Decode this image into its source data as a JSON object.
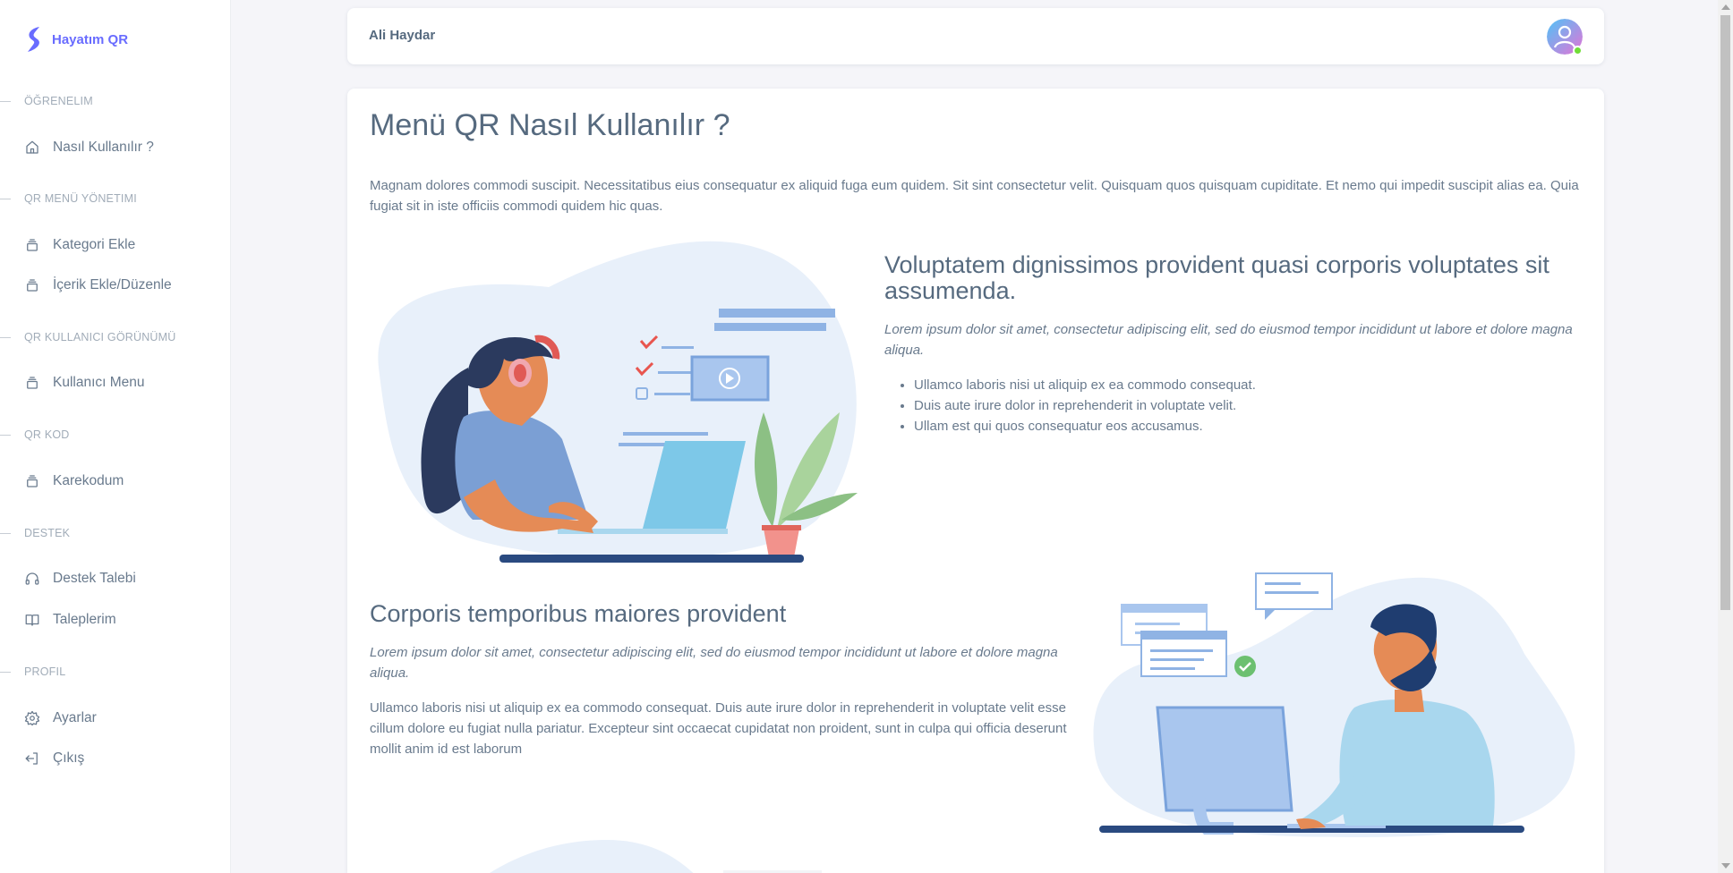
{
  "sidebar": {
    "brand": "Hayatım QR",
    "sections": [
      {
        "header": "ÖĞRENELIM",
        "items": [
          {
            "label": "Nasıl Kullanılır ?",
            "icon": "home-icon"
          }
        ]
      },
      {
        "header": "QR MENÜ YÖNETIMI",
        "items": [
          {
            "label": "Kategori Ekle",
            "icon": "layers-icon"
          },
          {
            "label": "İçerik Ekle/Düzenle",
            "icon": "layers-icon"
          }
        ]
      },
      {
        "header": "QR KULLANICI GÖRÜNÜMÜ",
        "items": [
          {
            "label": "Kullanıcı Menu",
            "icon": "layers-icon"
          }
        ]
      },
      {
        "header": "QR KOD",
        "items": [
          {
            "label": "Karekodum",
            "icon": "layers-icon"
          }
        ]
      },
      {
        "header": "DESTEK",
        "items": [
          {
            "label": "Destek Talebi",
            "icon": "headphones-icon"
          },
          {
            "label": "Taleplerim",
            "icon": "book-icon"
          }
        ]
      },
      {
        "header": "PROFIL",
        "items": [
          {
            "label": "Ayarlar",
            "icon": "gear-icon"
          },
          {
            "label": "Çıkış",
            "icon": "logout-icon"
          }
        ]
      }
    ]
  },
  "navbar": {
    "user_name": "Ali Haydar"
  },
  "main": {
    "title": "Menü QR Nasıl Kullanılır ?",
    "intro": "Magnam dolores commodi suscipit. Necessitatibus eius consequatur ex aliquid fuga eum quidem. Sit sint consectetur velit. Quisquam quos quisquam cupiditate. Et nemo qui impedit suscipit alias ea. Quia fugiat sit in iste officiis commodi quidem hic quas.",
    "section1": {
      "title": "Voluptatem dignissimos provident quasi corporis voluptates sit assumenda.",
      "subtitle": "Lorem ipsum dolor sit amet, consectetur adipiscing elit, sed do eiusmod tempor incididunt ut labore et dolore magna aliqua.",
      "bullets": [
        "Ullamco laboris nisi ut aliquip ex ea commodo consequat.",
        "Duis aute irure dolor in reprehenderit in voluptate velit.",
        "Ullam est qui quos consequatur eos accusamus."
      ]
    },
    "section2": {
      "title": "Corporis temporibus maiores provident",
      "subtitle": "Lorem ipsum dolor sit amet, consectetur adipiscing elit, sed do eiusmod tempor incididunt ut labore et dolore magna aliqua.",
      "body": "Ullamco laboris nisi ut aliquip ex ea commodo consequat. Duis aute irure dolor in reprehenderit in voluptate velit esse cillum dolore eu fugiat nulla pariatur. Excepteur sint occaecat cupidatat non proident, sunt in culpa qui officia deserunt mollit anim id est laborum"
    }
  },
  "colors": {
    "brand": "#696cff",
    "text": "#566a7f",
    "muted": "#a1acb8",
    "blob": "#e8f0fa",
    "online": "#71dd37"
  }
}
